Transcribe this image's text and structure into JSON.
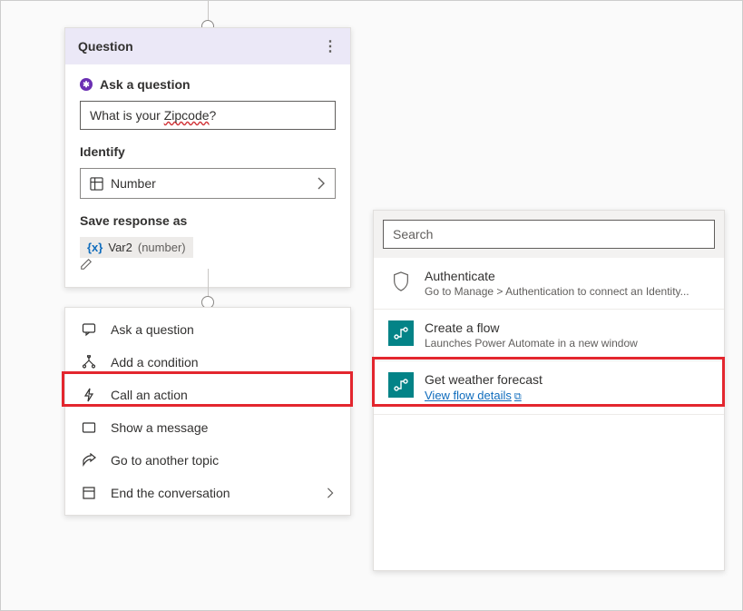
{
  "question_card": {
    "title": "Question",
    "ask_label": "Ask a question",
    "question_prefix": "What is your ",
    "question_spell": "Zipcode",
    "question_suffix": "?",
    "identify_label": "Identify",
    "identify_value": "Number",
    "save_label": "Save response as",
    "var_name": "Var2",
    "var_type": "(number)"
  },
  "action_menu": {
    "items": [
      {
        "icon": "chat-icon",
        "label": "Ask a question"
      },
      {
        "icon": "branch-icon",
        "label": "Add a condition"
      },
      {
        "icon": "bolt-icon",
        "label": "Call an action"
      },
      {
        "icon": "message-icon",
        "label": "Show a message"
      },
      {
        "icon": "share-icon",
        "label": "Go to another topic"
      },
      {
        "icon": "end-icon",
        "label": "End the conversation",
        "chevron": true
      }
    ]
  },
  "right_panel": {
    "search_placeholder": "Search",
    "items": [
      {
        "icon": "shield-icon",
        "title": "Authenticate",
        "subtitle": "Go to Manage > Authentication to connect an Identity..."
      },
      {
        "icon": "flow-icon",
        "title": "Create a flow",
        "subtitle": "Launches Power Automate in a new window"
      },
      {
        "icon": "flow-icon",
        "title": "Get weather forecast",
        "link": "View flow details"
      }
    ]
  }
}
